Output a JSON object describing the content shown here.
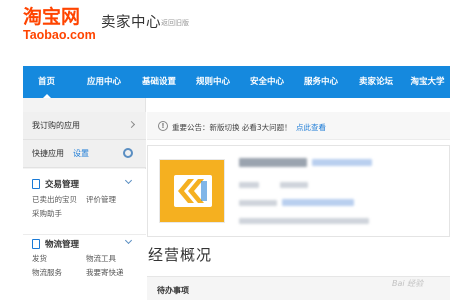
{
  "header": {
    "logo_main": "淘宝网",
    "logo_sub": "Taobao.com",
    "title": "卖家中心",
    "back_link": "返回旧版"
  },
  "nav": {
    "items": [
      {
        "label": "首页",
        "active": true
      },
      {
        "label": "应用中心"
      },
      {
        "label": "基础设置"
      },
      {
        "label": "规则中心"
      },
      {
        "label": "安全中心"
      },
      {
        "label": "服务中心"
      },
      {
        "label": "卖家论坛"
      },
      {
        "label": "淘宝大学"
      }
    ]
  },
  "sidebar": {
    "subscribed_apps": "我订购的应用",
    "quick_apps": "快捷应用",
    "quick_settings": "设置",
    "groups": [
      {
        "title": "交易管理",
        "links": [
          "已卖出的宝贝",
          "评价管理",
          "采购助手"
        ]
      },
      {
        "title": "物流管理",
        "links": [
          "发货",
          "物流工具",
          "物流服务",
          "我要寄快递"
        ]
      }
    ]
  },
  "notice": {
    "text": "重要公告：新版切换 必看3大问题！",
    "link": "点此查看"
  },
  "main": {
    "section_title": "经营概况",
    "todo_title": "待办事项"
  },
  "watermark": "Bai 经验",
  "colors": {
    "brand": "#ff4400",
    "nav_bg": "#1589de",
    "link": "#1a7ad6",
    "avatar_bg": "#f5b020"
  }
}
